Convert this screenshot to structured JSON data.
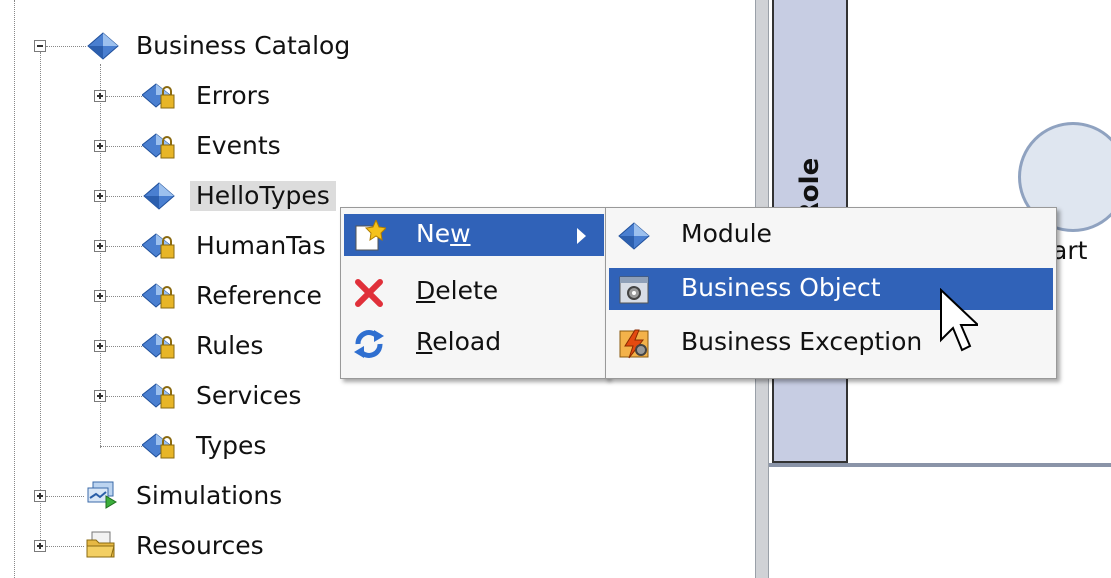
{
  "tree": {
    "root": {
      "label": "Business Catalog",
      "icon": "business-catalog-icon"
    },
    "children": [
      {
        "label": "Errors",
        "icon": "locked-module-icon"
      },
      {
        "label": "Events",
        "icon": "locked-module-icon"
      },
      {
        "label": "HelloTypes",
        "icon": "module-icon",
        "selected": true
      },
      {
        "label": "HumanTas",
        "icon": "locked-module-icon"
      },
      {
        "label": "Reference",
        "icon": "locked-module-icon"
      },
      {
        "label": "Rules",
        "icon": "locked-module-icon"
      },
      {
        "label": "Services",
        "icon": "locked-module-icon"
      },
      {
        "label": "Types",
        "icon": "locked-module-icon"
      }
    ],
    "siblings": [
      {
        "label": "Simulations",
        "icon": "simulations-icon"
      },
      {
        "label": "Resources",
        "icon": "resources-folder-icon"
      }
    ]
  },
  "context_menu": {
    "items": [
      {
        "pre": "Ne",
        "ul": "w",
        "post": "",
        "icon": "new-icon",
        "highlighted": true,
        "has_submenu": true
      },
      {
        "pre": "",
        "ul": "D",
        "post": "elete",
        "icon": "delete-icon"
      },
      {
        "pre": "",
        "ul": "R",
        "post": "eload",
        "icon": "reload-icon"
      }
    ]
  },
  "submenu": {
    "items": [
      {
        "label": "Module",
        "icon": "module-icon"
      },
      {
        "label": "Business Object",
        "icon": "business-object-icon",
        "highlighted": true
      },
      {
        "label": "Business Exception",
        "icon": "business-exception-icon"
      }
    ]
  },
  "diagram": {
    "role_label": "Role",
    "start_label": "art"
  }
}
